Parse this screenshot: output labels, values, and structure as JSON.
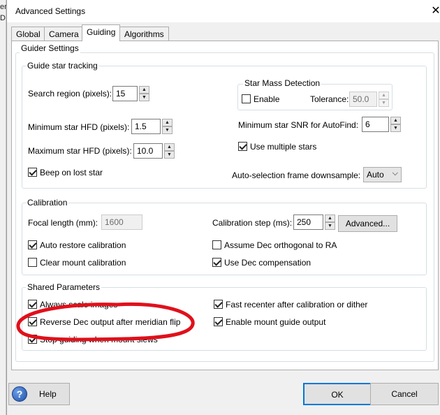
{
  "outer_fragments": [
    "er",
    "D"
  ],
  "window": {
    "title": "Advanced Settings",
    "close_glyph": "✕"
  },
  "tabs": [
    "Global",
    "Camera",
    "Guiding",
    "Algorithms"
  ],
  "active_tab": "Guiding",
  "guider_settings": {
    "title": "Guider Settings",
    "tracking": {
      "title": "Guide star tracking",
      "search_region_label": "Search region (pixels):",
      "search_region_value": "15",
      "min_hfd_label": "Minimum star HFD (pixels):",
      "min_hfd_value": "1.5",
      "max_hfd_label": "Maximum star HFD (pixels):",
      "max_hfd_value": "10.0",
      "beep_label": "Beep on lost star",
      "beep_checked": true,
      "star_mass": {
        "title": "Star Mass Detection",
        "enable_label": "Enable",
        "enable_checked": false,
        "tolerance_label": "Tolerance:",
        "tolerance_value": "50.0"
      },
      "min_snr_label": "Minimum star SNR for AutoFind:",
      "min_snr_value": "6",
      "multiple_stars_label": "Use multiple stars",
      "multiple_stars_checked": true,
      "downsample_label": "Auto-selection frame downsample:",
      "downsample_value": "Auto"
    },
    "calibration": {
      "title": "Calibration",
      "focal_length_label": "Focal length (mm):",
      "focal_length_value": "1600",
      "cal_step_label": "Calibration step (ms):",
      "cal_step_value": "250",
      "advanced_button": "Advanced...",
      "auto_restore_label": "Auto restore calibration",
      "auto_restore_checked": true,
      "assume_dec_label": "Assume Dec orthogonal to RA",
      "assume_dec_checked": false,
      "clear_mount_label": "Clear mount calibration",
      "clear_mount_checked": false,
      "use_dec_comp_label": "Use Dec compensation",
      "use_dec_comp_checked": true
    },
    "shared": {
      "title": "Shared Parameters",
      "always_scale_label": "Always scale images",
      "always_scale_checked": true,
      "fast_recenter_label": "Fast recenter after calibration or dither",
      "fast_recenter_checked": true,
      "reverse_dec_label": "Reverse Dec output after meridian flip",
      "reverse_dec_checked": true,
      "enable_mount_label": "Enable mount guide output",
      "enable_mount_checked": true,
      "stop_guiding_label": "Stop guiding when mount slews",
      "stop_guiding_checked": true
    }
  },
  "footer": {
    "help_label": "Help",
    "help_icon_glyph": "?",
    "ok_label": "OK",
    "cancel_label": "Cancel"
  },
  "annotation_color": "#e0101b",
  "accent_color": "#0078d7"
}
